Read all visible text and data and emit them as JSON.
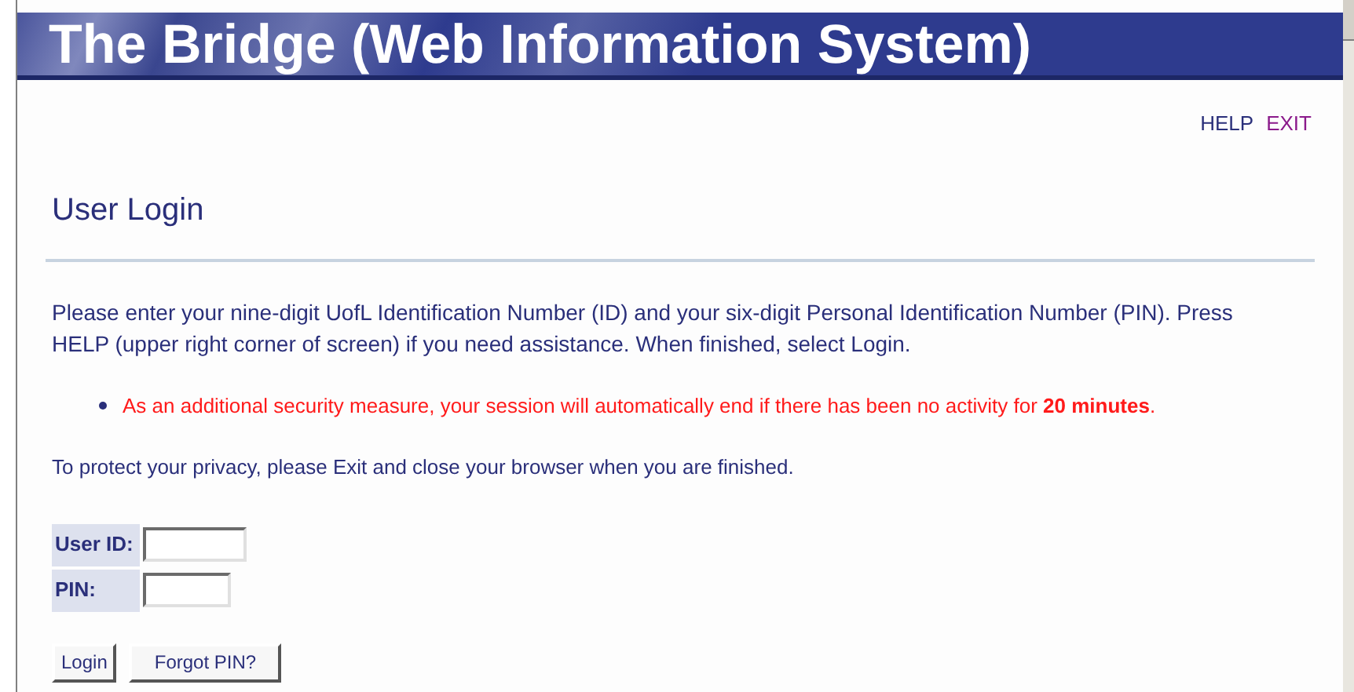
{
  "banner": {
    "title": "The Bridge (Web Information System)"
  },
  "top_links": [
    {
      "label": "HELP",
      "visited": false
    },
    {
      "label": "EXIT",
      "visited": true
    }
  ],
  "heading": "User Login",
  "instructions": "Please enter your nine-digit UofL Identification Number (ID) and your six-digit Personal Identification Number (PIN). Press HELP (upper right corner of screen) if you need assistance. When finished, select Login.",
  "notices": [
    "As an additional security measure, your session will automatically end if there has been no activity for **20 minutes**."
  ],
  "privacy_note": "To protect your privacy, please Exit and close your browser when you are finished.",
  "form": {
    "fields": [
      {
        "label": "User ID:"
      },
      {
        "label": "PIN:"
      }
    ],
    "buttons": [
      "Login",
      "Forgot PIN?"
    ]
  }
}
